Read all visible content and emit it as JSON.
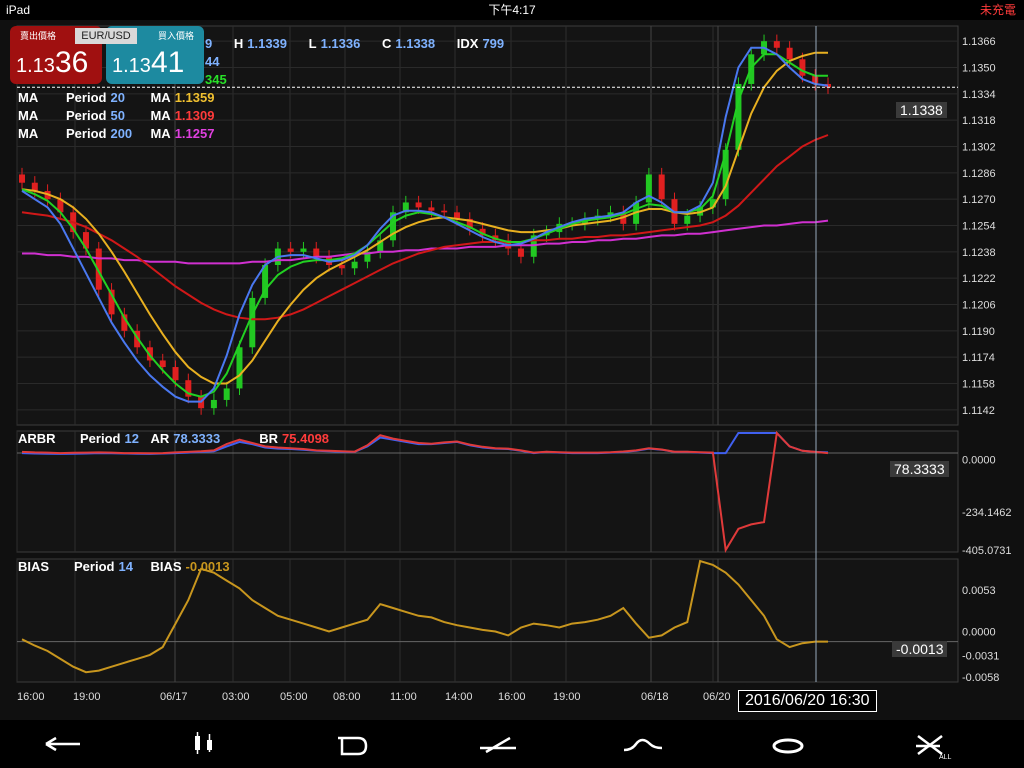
{
  "status": {
    "device": "iPad",
    "time": "下午4:17",
    "battery": "未充電"
  },
  "quote": {
    "sell_label": "賣出價格",
    "buy_label": "買入價格",
    "pair": "EUR/USD",
    "sell_small": "1.13",
    "sell_big": "36",
    "buy_small": "1.13",
    "buy_big": "41"
  },
  "ohlc": {
    "o_val": "9",
    "h_label": "H",
    "h_val": "1.1339",
    "l_label": "L",
    "l_val": "1.1336",
    "c_label": "C",
    "c_val": "1.1338",
    "idx_label": "IDX",
    "idx_val": "799"
  },
  "ma_hidden": {
    "v1": "44",
    "v2": "345"
  },
  "ma_rows": [
    {
      "label": "MA",
      "period_label": "Period",
      "period": "20",
      "ma_label": "MA",
      "value": "1.1359",
      "color": "#f0c030"
    },
    {
      "label": "MA",
      "period_label": "Period",
      "period": "50",
      "ma_label": "MA",
      "value": "1.1309",
      "color": "#ff3b3b"
    },
    {
      "label": "MA",
      "period_label": "Period",
      "period": "200",
      "ma_label": "MA",
      "value": "1.1257",
      "color": "#e040e0"
    }
  ],
  "current_price": "1.1338",
  "arbr": {
    "title": "ARBR",
    "period_label": "Period",
    "period": "12",
    "ar_label": "AR",
    "ar_val": "78.3333",
    "br_label": "BR",
    "br_val": "75.4098",
    "current": "78.3333"
  },
  "bias": {
    "title": "BIAS",
    "period_label": "Period",
    "period": "14",
    "bias_label": "BIAS",
    "bias_val": "-0.0013",
    "current": "-0.0013"
  },
  "date_readout": "2016/06/20 16:30",
  "toolbar": {
    "items": [
      "arrow-left-icon",
      "candle-type-icon",
      "draw-d-icon",
      "line-tool-icon",
      "curve-tool-icon",
      "circle-tool-icon",
      "close-all-icon"
    ],
    "close_sub": "ALL"
  },
  "chart_data": [
    {
      "type": "line",
      "panel": "price",
      "y_ticks": [
        "1.1366",
        "1.1350",
        "1.1334",
        "1.1318",
        "1.1302",
        "1.1286",
        "1.1270",
        "1.1254",
        "1.1238",
        "1.1222",
        "1.1206",
        "1.1190",
        "1.1174",
        "1.1158",
        "1.1142"
      ],
      "ylim": [
        1.1134,
        1.1374
      ],
      "x_ticks": [
        "16:00",
        "19:00",
        "06/17",
        "03:00",
        "05:00",
        "08:00",
        "11:00",
        "14:00",
        "16:00",
        "19:00",
        "06/18",
        "06/20"
      ],
      "close": [
        1.128,
        1.1275,
        1.127,
        1.1262,
        1.125,
        1.124,
        1.1215,
        1.12,
        1.119,
        1.118,
        1.1172,
        1.1168,
        1.116,
        1.115,
        1.1143,
        1.1148,
        1.1155,
        1.118,
        1.121,
        1.123,
        1.124,
        1.1238,
        1.124,
        1.1235,
        1.123,
        1.1228,
        1.1232,
        1.1238,
        1.1245,
        1.1262,
        1.1268,
        1.1265,
        1.1263,
        1.1262,
        1.1258,
        1.1252,
        1.1248,
        1.1245,
        1.124,
        1.1235,
        1.1248,
        1.125,
        1.1255,
        1.1255,
        1.1258,
        1.126,
        1.1262,
        1.1255,
        1.1268,
        1.1285,
        1.127,
        1.1255,
        1.126,
        1.1265,
        1.127,
        1.13,
        1.134,
        1.1358,
        1.1366,
        1.1362,
        1.1355,
        1.1345,
        1.134,
        1.1338
      ],
      "ma_fast_blue": [
        1.1275,
        1.127,
        1.1265,
        1.1255,
        1.124,
        1.1225,
        1.121,
        1.1195,
        1.1183,
        1.1172,
        1.1163,
        1.1156,
        1.115,
        1.1147,
        1.1147,
        1.1155,
        1.1175,
        1.12,
        1.1218,
        1.123,
        1.1235,
        1.1236,
        1.1236,
        1.1234,
        1.1232,
        1.1233,
        1.1236,
        1.1242,
        1.1252,
        1.126,
        1.1263,
        1.1263,
        1.1262,
        1.1259,
        1.1255,
        1.1251,
        1.1247,
        1.1244,
        1.1242,
        1.1243,
        1.1246,
        1.125,
        1.1253,
        1.1256,
        1.1258,
        1.1259,
        1.126,
        1.1262,
        1.1268,
        1.1272,
        1.1268,
        1.1262,
        1.1262,
        1.1266,
        1.128,
        1.132,
        1.135,
        1.1362,
        1.1362,
        1.1358,
        1.135,
        1.1343,
        1.134,
        1.1339
      ],
      "ma_green": [
        1.1276,
        1.1273,
        1.1269,
        1.1262,
        1.1252,
        1.124,
        1.1226,
        1.1212,
        1.1198,
        1.1186,
        1.1175,
        1.1166,
        1.1158,
        1.1152,
        1.115,
        1.1153,
        1.1164,
        1.1182,
        1.12,
        1.1215,
        1.1224,
        1.1229,
        1.1232,
        1.1233,
        1.1233,
        1.1234,
        1.1237,
        1.1242,
        1.1249,
        1.1256,
        1.126,
        1.1262,
        1.1261,
        1.1259,
        1.1256,
        1.1253,
        1.1249,
        1.1246,
        1.1244,
        1.1244,
        1.1246,
        1.1249,
        1.1252,
        1.1255,
        1.1257,
        1.1258,
        1.1259,
        1.1261,
        1.1264,
        1.1267,
        1.1266,
        1.1262,
        1.1262,
        1.1264,
        1.1272,
        1.1298,
        1.133,
        1.135,
        1.1358,
        1.1358,
        1.1353,
        1.1348,
        1.1345,
        1.1345
      ],
      "ma20": [
        1.1276,
        1.1275,
        1.1273,
        1.127,
        1.1265,
        1.1258,
        1.1249,
        1.1238,
        1.1226,
        1.1213,
        1.12,
        1.1188,
        1.1177,
        1.1168,
        1.1162,
        1.1158,
        1.1158,
        1.1163,
        1.1172,
        1.1184,
        1.1196,
        1.1206,
        1.1215,
        1.1222,
        1.1227,
        1.1231,
        1.1235,
        1.1239,
        1.1244,
        1.1249,
        1.1253,
        1.1256,
        1.1258,
        1.1259,
        1.1258,
        1.1257,
        1.1255,
        1.1253,
        1.1251,
        1.125,
        1.125,
        1.1251,
        1.1252,
        1.1254,
        1.1255,
        1.1256,
        1.1257,
        1.1259,
        1.1262,
        1.1264,
        1.1264,
        1.1262,
        1.1261,
        1.1262,
        1.1265,
        1.1278,
        1.13,
        1.1322,
        1.1338,
        1.1348,
        1.1354,
        1.1357,
        1.1359,
        1.1359
      ],
      "ma50": [
        1.1262,
        1.1261,
        1.126,
        1.1258,
        1.1256,
        1.1253,
        1.1249,
        1.1245,
        1.124,
        1.1235,
        1.1229,
        1.1223,
        1.1217,
        1.1212,
        1.1207,
        1.1203,
        1.12,
        1.1198,
        1.1197,
        1.1197,
        1.1198,
        1.12,
        1.1203,
        1.1207,
        1.1211,
        1.1215,
        1.1219,
        1.1223,
        1.1227,
        1.1231,
        1.1234,
        1.1237,
        1.1239,
        1.1241,
        1.1242,
        1.1243,
        1.1244,
        1.1244,
        1.1244,
        1.1244,
        1.1245,
        1.1245,
        1.1246,
        1.1246,
        1.1247,
        1.1247,
        1.1248,
        1.1248,
        1.1249,
        1.125,
        1.1251,
        1.1252,
        1.1253,
        1.1254,
        1.1256,
        1.126,
        1.1266,
        1.1274,
        1.1282,
        1.129,
        1.1296,
        1.1302,
        1.1306,
        1.1309
      ],
      "ma200": [
        1.1237,
        1.1237,
        1.1236,
        1.1236,
        1.1235,
        1.1235,
        1.1234,
        1.1234,
        1.1233,
        1.1233,
        1.1232,
        1.1232,
        1.1232,
        1.1231,
        1.1231,
        1.1231,
        1.1231,
        1.1231,
        1.1232,
        1.1232,
        1.1233,
        1.1233,
        1.1234,
        1.1235,
        1.1235,
        1.1236,
        1.1237,
        1.1237,
        1.1238,
        1.1238,
        1.1239,
        1.1239,
        1.124,
        1.124,
        1.124,
        1.1241,
        1.1241,
        1.1241,
        1.1242,
        1.1242,
        1.1242,
        1.1243,
        1.1243,
        1.1244,
        1.1244,
        1.1245,
        1.1245,
        1.1246,
        1.1246,
        1.1247,
        1.1248,
        1.1248,
        1.1249,
        1.1249,
        1.125,
        1.1251,
        1.1252,
        1.1253,
        1.1254,
        1.1254,
        1.1255,
        1.1256,
        1.1256,
        1.1257
      ]
    },
    {
      "type": "line",
      "panel": "arbr",
      "y_ticks": [
        "0.0000",
        "-234.1462",
        "-405.0731"
      ],
      "ar": [
        30,
        28,
        27,
        26,
        27,
        28,
        30,
        29,
        28,
        27,
        26,
        28,
        30,
        32,
        35,
        38,
        60,
        80,
        70,
        55,
        50,
        48,
        45,
        40,
        38,
        36,
        35,
        60,
        100,
        90,
        80,
        70,
        70,
        75,
        80,
        65,
        55,
        50,
        48,
        40,
        30,
        35,
        32,
        30,
        30,
        30,
        32,
        35,
        40,
        50,
        45,
        35,
        35,
        32,
        30,
        30,
        120,
        120,
        120,
        120,
        60,
        40,
        35,
        33
      ],
      "br": [
        35,
        33,
        32,
        30,
        31,
        32,
        33,
        32,
        30,
        30,
        29,
        30,
        33,
        35,
        38,
        42,
        70,
        90,
        75,
        60,
        55,
        52,
        48,
        42,
        40,
        38,
        36,
        65,
        110,
        95,
        85,
        75,
        72,
        78,
        82,
        68,
        58,
        52,
        50,
        42,
        32,
        36,
        34,
        32,
        32,
        32,
        34,
        37,
        42,
        52,
        46,
        36,
        36,
        34,
        32,
        -405,
        -310,
        -290,
        -280,
        120,
        60,
        40,
        35,
        30
      ]
    },
    {
      "type": "line",
      "panel": "bias",
      "y_ticks": [
        "0.0053",
        "0.0000",
        "-0.0031",
        "-0.0058"
      ],
      "bias": [
        -0.001,
        -0.0018,
        -0.0025,
        -0.0035,
        -0.0045,
        -0.0052,
        -0.005,
        -0.0045,
        -0.004,
        -0.0035,
        -0.003,
        -0.002,
        0.001,
        0.004,
        0.008,
        0.0075,
        0.0065,
        0.0055,
        0.004,
        0.003,
        0.002,
        0.0015,
        0.001,
        0.0005,
        0.0,
        0.0005,
        0.001,
        0.0015,
        0.0035,
        0.003,
        0.0025,
        0.002,
        0.0018,
        0.0012,
        0.0008,
        0.0005,
        0.0002,
        0.0,
        -0.0005,
        0.0005,
        0.001,
        0.0008,
        0.0005,
        0.001,
        0.0012,
        0.0015,
        0.002,
        0.003,
        0.001,
        -0.0008,
        -0.0005,
        0.0005,
        0.0012,
        0.009,
        0.0085,
        0.0075,
        0.006,
        0.004,
        0.002,
        -0.001,
        -0.002,
        -0.0015,
        -0.0013,
        -0.0013
      ]
    }
  ]
}
